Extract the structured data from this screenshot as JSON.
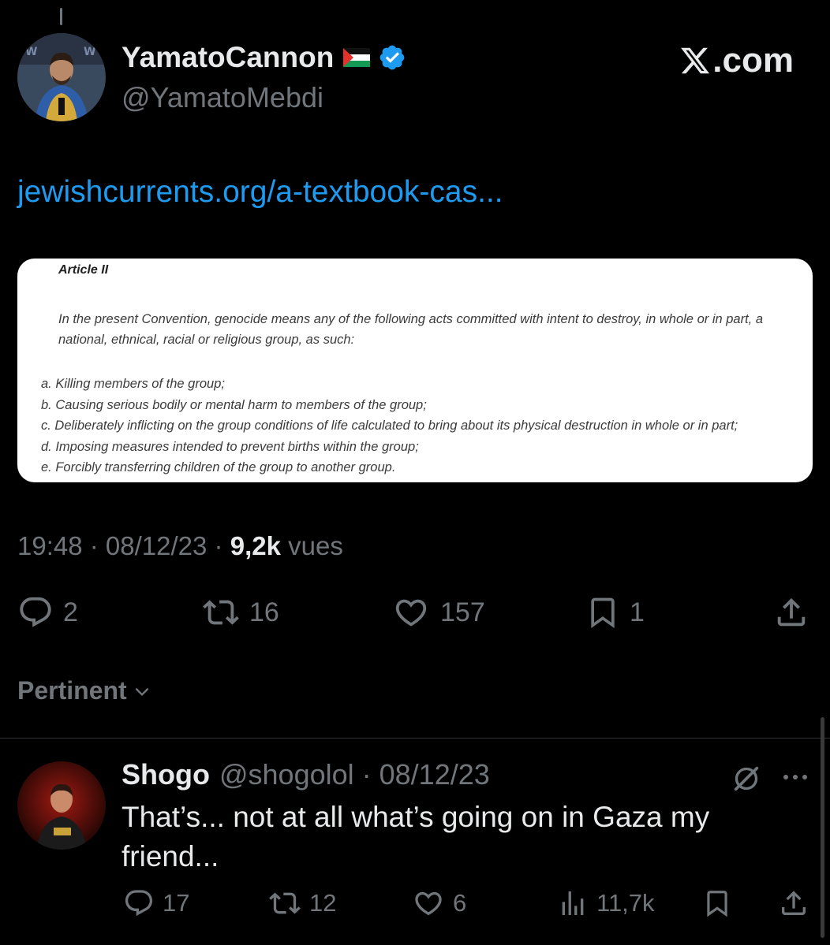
{
  "tweet": {
    "author_name": "YamatoCannon",
    "author_flag": "palestine-flag",
    "author_handle": "@YamatoMebdi",
    "brand": ".com",
    "link_text": "jewishcurrents.org/a-textbook-cas...",
    "card": {
      "heading": "Article II",
      "paragraph": "In the present Convention, genocide means any of the following acts committed with intent to destroy, in whole or in part, a national, ethnical, racial or religious group, as such:",
      "items": [
        "a. Killing members of the group;",
        "b. Causing serious bodily or mental harm to members of the group;",
        "c. Deliberately inflicting on the group conditions of life calculated to bring about its physical destruction in whole or in part;",
        "d. Imposing measures intended to prevent births within the group;",
        "e. Forcibly transferring children of the group to another group."
      ]
    },
    "time": "19:48",
    "date": "08/12/23",
    "views_count": "9,2k",
    "views_label": "vues",
    "replies": "2",
    "retweets": "16",
    "likes": "157",
    "bookmarks": "1"
  },
  "sort_label": "Pertinent",
  "reply": {
    "name": "Shogo",
    "handle": "@shogolol",
    "date": "08/12/23",
    "text": "That’s... not at all what’s going on in Gaza my friend...",
    "replies": "17",
    "retweets": "12",
    "likes": "6",
    "views": "11,7k"
  },
  "colors": {
    "background": "#000000",
    "text": "#e7e9ea",
    "muted": "#71767b",
    "link": "#1d9bf0",
    "verified": "#1d9bf0"
  }
}
